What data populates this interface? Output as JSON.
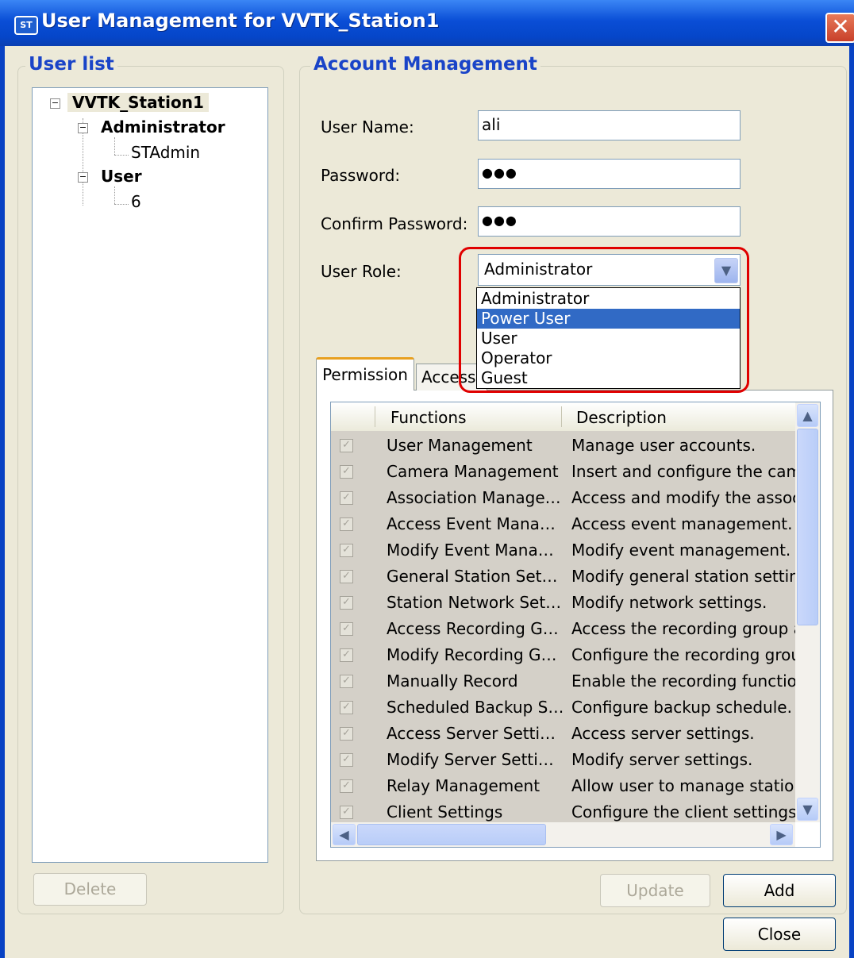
{
  "window": {
    "title": "User Management for VVTK_Station1",
    "icon_label": "ST",
    "close_glyph": "✕"
  },
  "user_list": {
    "legend": "User list",
    "tree": {
      "root": "VVTK_Station1",
      "groups": [
        {
          "label": "Administrator",
          "children": [
            "STAdmin"
          ]
        },
        {
          "label": "User",
          "children": [
            "6"
          ]
        }
      ]
    },
    "delete_label": "Delete"
  },
  "account": {
    "legend": "Account Management",
    "username_label": "User Name:",
    "username_value": "ali",
    "password_label": "Password:",
    "password_value": "●●●",
    "confirm_label": "Confirm Password:",
    "confirm_value": "●●●",
    "role_label": "User Role:",
    "role_value": "Administrator",
    "role_options": [
      "Administrator",
      "Power User",
      "User",
      "Operator",
      "Guest"
    ],
    "role_highlighted": "Power User"
  },
  "tabs": [
    {
      "label": "Permission",
      "active": true
    },
    {
      "label": "Accessi",
      "active": false
    }
  ],
  "permissions": {
    "col_functions": "Functions",
    "col_description": "Description",
    "rows": [
      {
        "checked": true,
        "function": "User Management",
        "description": "Manage user accounts."
      },
      {
        "checked": true,
        "function": "Camera Management",
        "description": "Insert and configure the came"
      },
      {
        "checked": true,
        "function": "Association Manage…",
        "description": "Access and modify the associa"
      },
      {
        "checked": true,
        "function": "Access Event Mana…",
        "description": "Access event management."
      },
      {
        "checked": true,
        "function": "Modify Event Mana…",
        "description": "Modify event management."
      },
      {
        "checked": true,
        "function": "General Station Set…",
        "description": "Modify general station setting"
      },
      {
        "checked": true,
        "function": "Station Network Set…",
        "description": "Modify network settings."
      },
      {
        "checked": true,
        "function": "Access Recording G…",
        "description": "Access the recording group ar"
      },
      {
        "checked": true,
        "function": "Modify Recording G…",
        "description": "Configure the recording group"
      },
      {
        "checked": true,
        "function": "Manually Record",
        "description": "Enable the recording function"
      },
      {
        "checked": true,
        "function": "Scheduled Backup S…",
        "description": "Configure backup schedule."
      },
      {
        "checked": true,
        "function": "Access Server Setti…",
        "description": "Access server settings."
      },
      {
        "checked": true,
        "function": "Modify Server Setti…",
        "description": "Modify server settings."
      },
      {
        "checked": true,
        "function": "Relay Management",
        "description": "Allow user to manage station r"
      },
      {
        "checked": true,
        "function": "Client Settings",
        "description": "Configure the client settings: :"
      }
    ]
  },
  "buttons": {
    "update": "Update",
    "add": "Add",
    "close": "Close"
  },
  "colors": {
    "titlebar": "#0a4ed6",
    "legend": "#1a44c8",
    "highlight": "#316ac5",
    "callout": "#e00000"
  }
}
